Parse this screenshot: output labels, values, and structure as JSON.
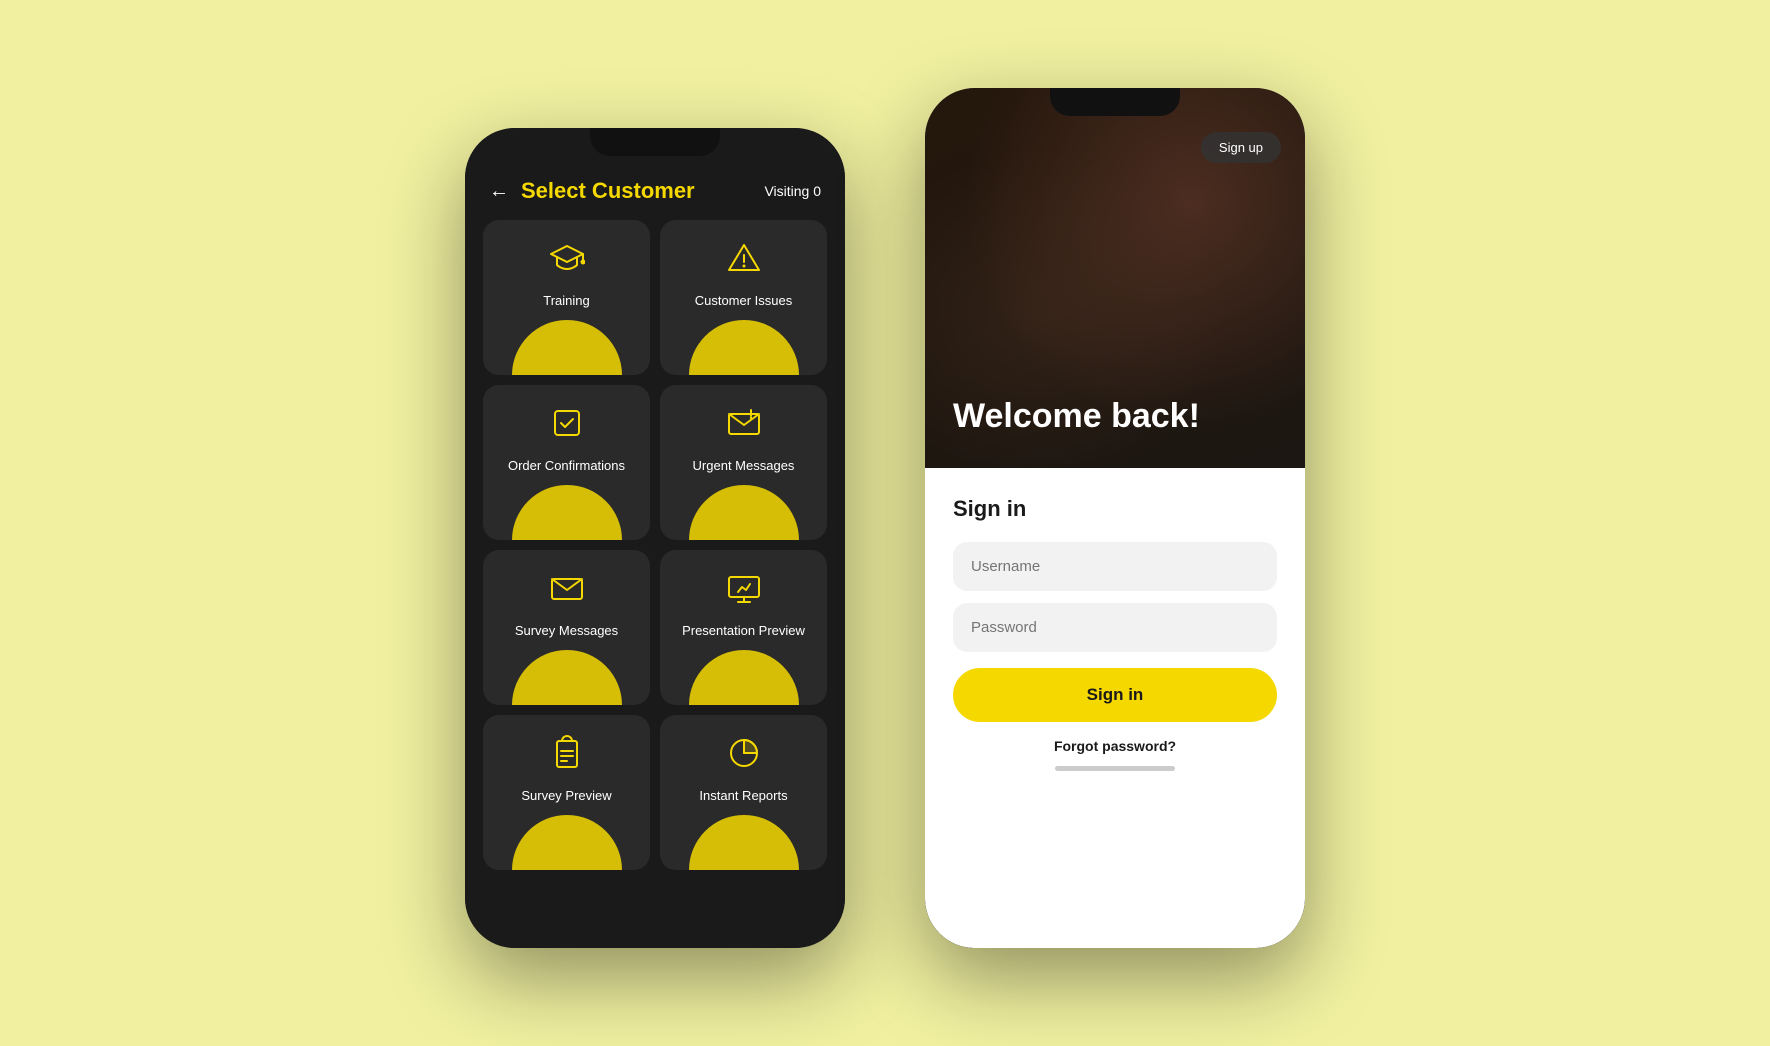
{
  "background_color": "#f0f0a0",
  "left_phone": {
    "header": {
      "back_label": "←",
      "title": "Select Customer",
      "visiting": "Visiting 0"
    },
    "grid_items": [
      {
        "id": "training",
        "label": "Training",
        "icon": "graduation-cap"
      },
      {
        "id": "customer-issues",
        "label": "Customer Issues",
        "icon": "alert-triangle"
      },
      {
        "id": "order-confirmations",
        "label": "Order Confirmations",
        "icon": "checkbox"
      },
      {
        "id": "urgent-messages",
        "label": "Urgent Messages",
        "icon": "envelope-exclaim"
      },
      {
        "id": "survey-messages",
        "label": "Survey Messages",
        "icon": "envelope"
      },
      {
        "id": "presentation-preview",
        "label": "Presentation Preview",
        "icon": "monitor"
      },
      {
        "id": "survey-preview",
        "label": "Survey Preview",
        "icon": "clipboard"
      },
      {
        "id": "instant-reports",
        "label": "Instant Reports",
        "icon": "pie-chart"
      }
    ]
  },
  "right_phone": {
    "signup_label": "Sign up",
    "welcome_text": "Welcome back!",
    "signin_section": {
      "title": "Sign in",
      "username_placeholder": "Username",
      "password_placeholder": "Password",
      "signin_button": "Sign in",
      "forgot_password": "Forgot password?"
    }
  }
}
